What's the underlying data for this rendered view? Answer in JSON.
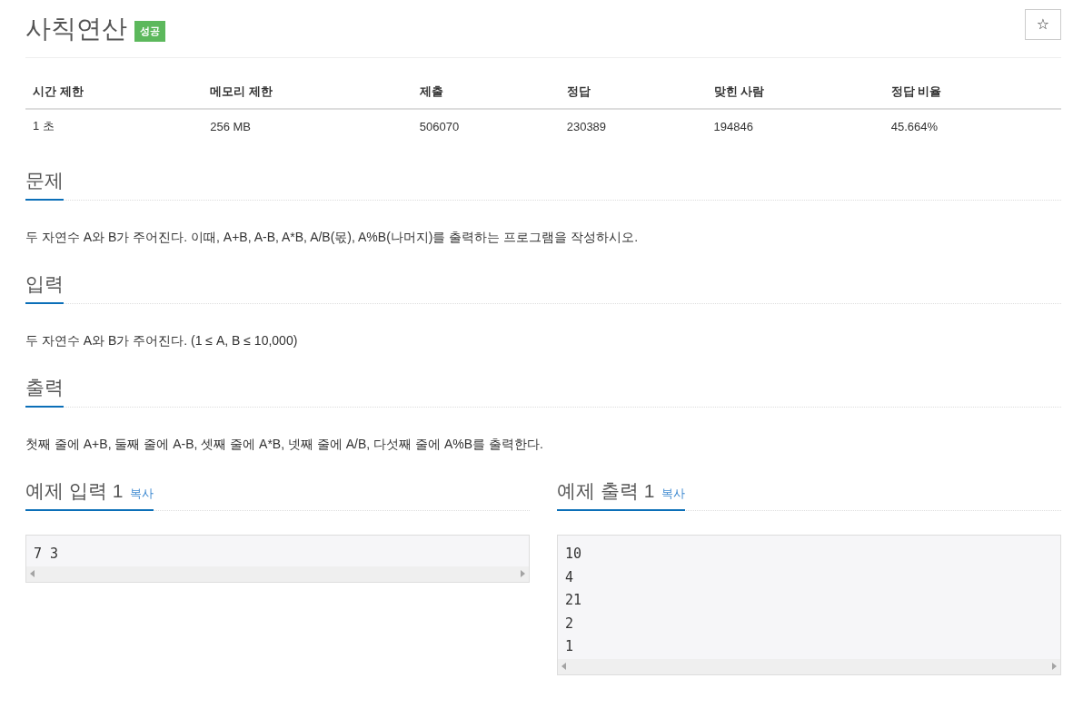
{
  "title": "사칙연산",
  "badge": "성공",
  "star": "☆",
  "info_table": {
    "columns": [
      "시간 제한",
      "메모리 제한",
      "제출",
      "정답",
      "맞힌 사람",
      "정답 비율"
    ],
    "rows": [
      [
        "1 초",
        "256 MB",
        "506070",
        "230389",
        "194846",
        "45.664%"
      ]
    ]
  },
  "sections": [
    {
      "heading": "문제",
      "text": "두 자연수 A와 B가 주어진다. 이때, A+B, A-B, A*B, A/B(몫), A%B(나머지)를 출력하는 프로그램을 작성하시오."
    },
    {
      "heading": "입력",
      "text": "두 자연수 A와 B가 주어진다. (1 ≤ A, B ≤ 10,000)"
    },
    {
      "heading": "출력",
      "text": "첫째 줄에 A+B, 둘째 줄에 A-B, 셋째 줄에 A*B, 넷째 줄에 A/B, 다섯째 줄에 A%B를 출력한다."
    }
  ],
  "samples": [
    {
      "heading": "예제 입력 1",
      "copy": "복사",
      "lines": [
        "7 3"
      ]
    },
    {
      "heading": "예제 출력 1",
      "copy": "복사",
      "lines": [
        "10",
        "4",
        "21",
        "2",
        "1"
      ]
    }
  ]
}
